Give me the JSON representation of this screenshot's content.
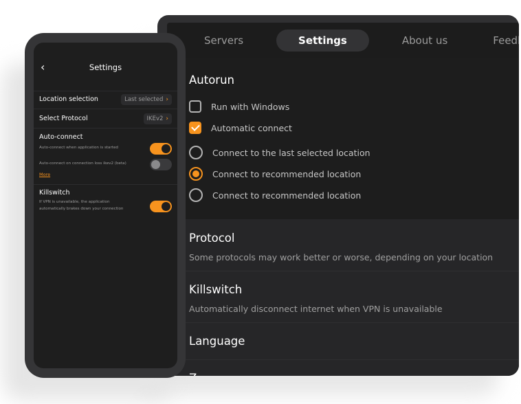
{
  "colors": {
    "accent": "#f7931e",
    "background_dark": "#1e1e1e",
    "panel": "#262628"
  },
  "desktop": {
    "tabs": [
      {
        "label": "Servers",
        "active": false
      },
      {
        "label": "Settings",
        "active": true
      },
      {
        "label": "About us",
        "active": false
      },
      {
        "label": "Feedback",
        "active": false
      }
    ],
    "autorun": {
      "title": "Autorun",
      "options": [
        {
          "type": "checkbox",
          "label": "Run with Windows",
          "checked": false
        },
        {
          "type": "checkbox",
          "label": "Automatic connect",
          "checked": true
        },
        {
          "type": "radio",
          "label": "Connect to the last selected location",
          "checked": false
        },
        {
          "type": "radio",
          "label": "Connect to recommended location",
          "checked": true
        },
        {
          "type": "radio",
          "label": "Connect to recommended location",
          "checked": false
        }
      ]
    },
    "sections": [
      {
        "title": "Protocol",
        "description": "Some protocols may work better or worse, depending on your location"
      },
      {
        "title": "Killswitch",
        "description": "Automatically disconnect internet when VPN is unavailable"
      },
      {
        "title": "Language",
        "description": ""
      },
      {
        "title": "Z",
        "description": ""
      }
    ]
  },
  "phone": {
    "back_icon": "chevron-left-icon",
    "back_glyph": "‹",
    "title": "Settings",
    "location_selection": {
      "label": "Location selection",
      "value": "Last selected",
      "chevron": "›"
    },
    "select_protocol": {
      "label": "Select Protocol",
      "value": "IKEv2",
      "chevron": "›"
    },
    "auto_connect": {
      "label": "Auto-connect",
      "on_start_text": "Auto-connect when application is started",
      "on_start_enabled": true,
      "on_loss_text": "Auto-connect on connection loss ikev2 (beta)",
      "on_loss_enabled": false,
      "more_link": "More"
    },
    "killswitch": {
      "label": "Killswitch",
      "line1": "If VPN is unavailable, the application",
      "line2": "automatically brakes down your connection",
      "enabled": true
    }
  }
}
